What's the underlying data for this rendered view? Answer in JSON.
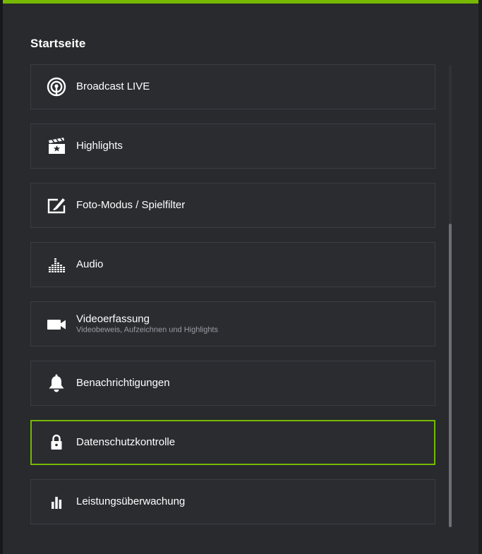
{
  "panel": {
    "title": "Startseite"
  },
  "menu": {
    "items": [
      {
        "label": "Broadcast LIVE",
        "sublabel": "",
        "icon": "broadcast-icon"
      },
      {
        "label": "Highlights",
        "sublabel": "",
        "icon": "clapperboard-star-icon"
      },
      {
        "label": "Foto-Modus / Spielfilter",
        "sublabel": "",
        "icon": "photo-edit-icon"
      },
      {
        "label": "Audio",
        "sublabel": "",
        "icon": "equalizer-icon"
      },
      {
        "label": "Videoerfassung",
        "sublabel": "Videobeweis, Aufzeichnen und Highlights",
        "icon": "video-camera-icon"
      },
      {
        "label": "Benachrichtigungen",
        "sublabel": "",
        "icon": "bell-icon"
      },
      {
        "label": "Datenschutzkontrolle",
        "sublabel": "",
        "icon": "lock-icon",
        "selected": true
      },
      {
        "label": "Leistungsüberwachung",
        "sublabel": "",
        "icon": "bar-chart-icon"
      }
    ]
  },
  "colors": {
    "accent": "#76b900",
    "background": "#282a2e",
    "item_border": "#3a3d42",
    "text": "#ffffff",
    "subtext": "#9a9da2"
  }
}
